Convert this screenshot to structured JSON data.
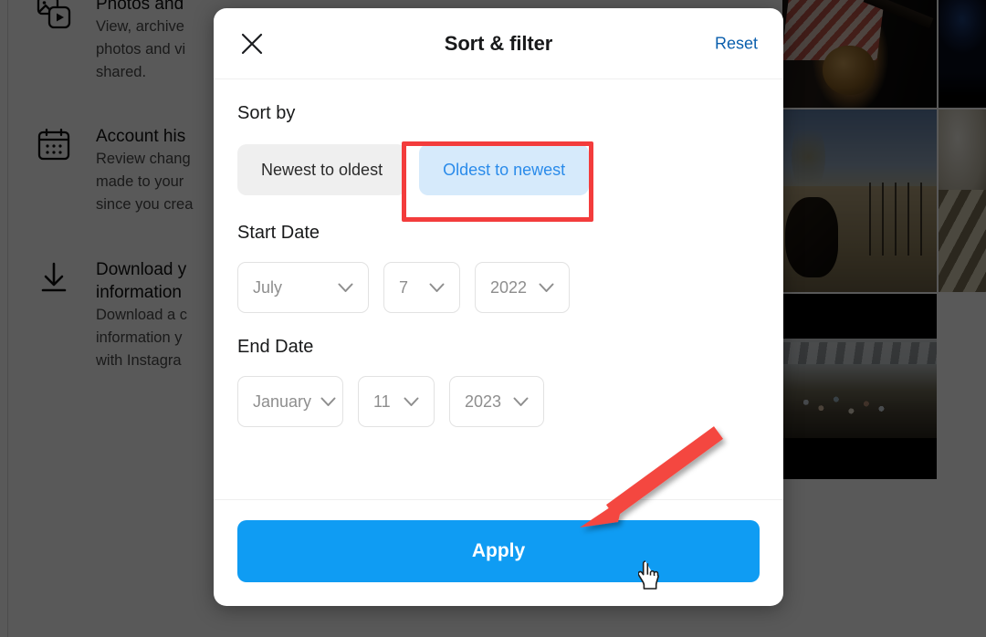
{
  "background": {
    "settings_items": [
      {
        "icon": "photos-videos-icon",
        "title": "Photos and ",
        "description": "View, archive \nphotos and vi\nshared."
      },
      {
        "icon": "calendar-icon",
        "title": "Account his",
        "description": "Review chang\nmade to your \nsince you crea"
      },
      {
        "icon": "download-icon",
        "title": "Download y\ninformation",
        "description": "Download a c\ninformation y\nwith Instagra"
      }
    ],
    "photos": [
      {
        "name": "photo-guitarist"
      },
      {
        "name": "photo-night-sky"
      },
      {
        "name": "photo-goat-field"
      },
      {
        "name": "photo-fur-stairs"
      },
      {
        "name": "photo-snow-village"
      }
    ]
  },
  "modal": {
    "title": "Sort & filter",
    "close_label": "×",
    "reset_label": "Reset",
    "sort": {
      "section_label": "Sort by",
      "options": [
        {
          "label": "Newest to oldest",
          "selected": false
        },
        {
          "label": "Oldest to newest",
          "selected": true
        }
      ]
    },
    "start_date": {
      "label": "Start Date",
      "month": "July",
      "day": "7",
      "year": "2022"
    },
    "end_date": {
      "label": "End Date",
      "month": "January",
      "day": "11",
      "year": "2023"
    },
    "apply_label": "Apply"
  },
  "annotations": {
    "highlight_color": "#f33c3c",
    "arrow_color": "#f4473f",
    "highlight_target": "Oldest to newest",
    "arrow_target": "Apply"
  },
  "colors": {
    "accent_blue": "#0f9cf3",
    "selected_pill_bg": "#d6eafb",
    "selected_pill_text": "#2a8bea",
    "unselected_pill_bg": "#efefef",
    "reset_link": "#0b5fad",
    "overlay": "#575757"
  }
}
